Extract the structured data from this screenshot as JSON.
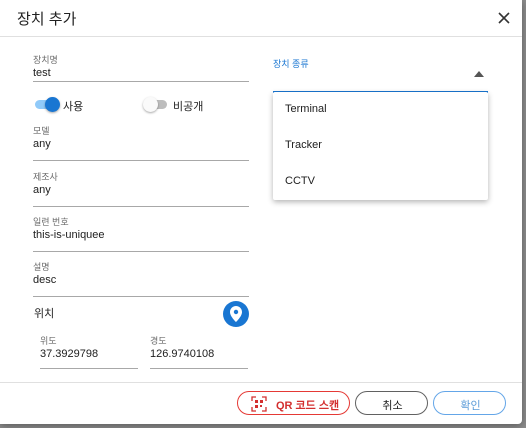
{
  "dialog": {
    "title": "장치 추가"
  },
  "form": {
    "device_name": {
      "label": "장치명",
      "value": "test"
    },
    "use_toggle": {
      "label": "사용",
      "on": true
    },
    "private_toggle": {
      "label": "비공개",
      "on": false
    },
    "model": {
      "label": "모델",
      "value": "any"
    },
    "manufacturer": {
      "label": "제조사",
      "value": "any"
    },
    "serial": {
      "label": "일련 번호",
      "value": "this-is-uniquee"
    },
    "description": {
      "label": "설명",
      "value": "desc"
    },
    "location": {
      "title": "위치",
      "latitude": {
        "label": "위도",
        "value": "37.3929798"
      },
      "longitude": {
        "label": "경도",
        "value": "126.9740108"
      }
    },
    "device_type": {
      "label": "장치 종류",
      "options": [
        "Terminal",
        "Tracker",
        "CCTV"
      ]
    }
  },
  "footer": {
    "qr_label": "QR 코드 스캔",
    "cancel_label": "취소",
    "ok_label": "확인"
  },
  "colors": {
    "primary": "#1976d2",
    "danger": "#e53935",
    "toggle_on_track": "#90caf9",
    "toggle_off_track": "#bdbdbd"
  },
  "icons": {
    "close": "close-icon",
    "location": "location-pin-icon",
    "qr": "qr-scan-icon",
    "dropdown": "dropdown-arrow-icon"
  }
}
